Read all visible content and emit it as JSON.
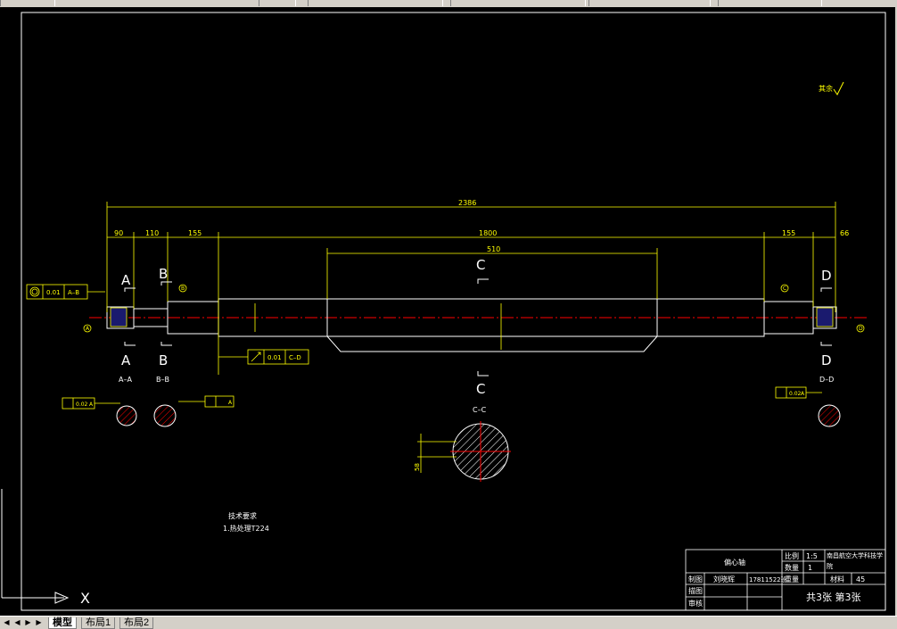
{
  "dims": {
    "overall": "2386",
    "d90": "90",
    "d110": "110",
    "d155_left": "155",
    "d1800": "1800",
    "d510": "510",
    "d155_right": "155",
    "d66": "66",
    "d58": "58"
  },
  "section_labels": {
    "a": "A",
    "b": "B",
    "c": "C",
    "d": "D",
    "aa": "A–A",
    "bb": "B–B",
    "cc": "C–C",
    "dd": "D–D"
  },
  "tolerance": {
    "cyl_value": "0.01",
    "cyl_datum": "A–B",
    "runout_value": "0.01",
    "runout_datum": "C–D",
    "sym_left": "0.02",
    "sym_left_datum": "A",
    "sym_mid_datum": "A",
    "sym_right": "0.02",
    "sym_right_datum": "A"
  },
  "datums": {
    "a": "A",
    "b": "B",
    "c": "C",
    "d": "D"
  },
  "notes": {
    "heading": "技术要求",
    "item1": "1.热处理T224",
    "roughness": "其余"
  },
  "title_block": {
    "part_name": "偏心轴",
    "scale_label": "比例",
    "scale_value": "1:5",
    "qty_label": "数量",
    "qty_value": "1",
    "weight_label": "重量",
    "material_label": "材料",
    "material_value": "45",
    "school": "南昌航空大学科技学院",
    "drafter_label": "制图",
    "drafter_name": "刘晓辉",
    "student_id": "17811522班",
    "designer_label": "描图",
    "reviewer_label": "审核",
    "sheet_info": "共3张 第3张"
  },
  "ucs_label": "X",
  "tabs": [
    "模型",
    "布局1",
    "布局2"
  ],
  "colors": {
    "drawing_yellow": "#ffff00",
    "outline_white": "#ffffff",
    "center_red": "#ff0000",
    "background": "#000000"
  }
}
